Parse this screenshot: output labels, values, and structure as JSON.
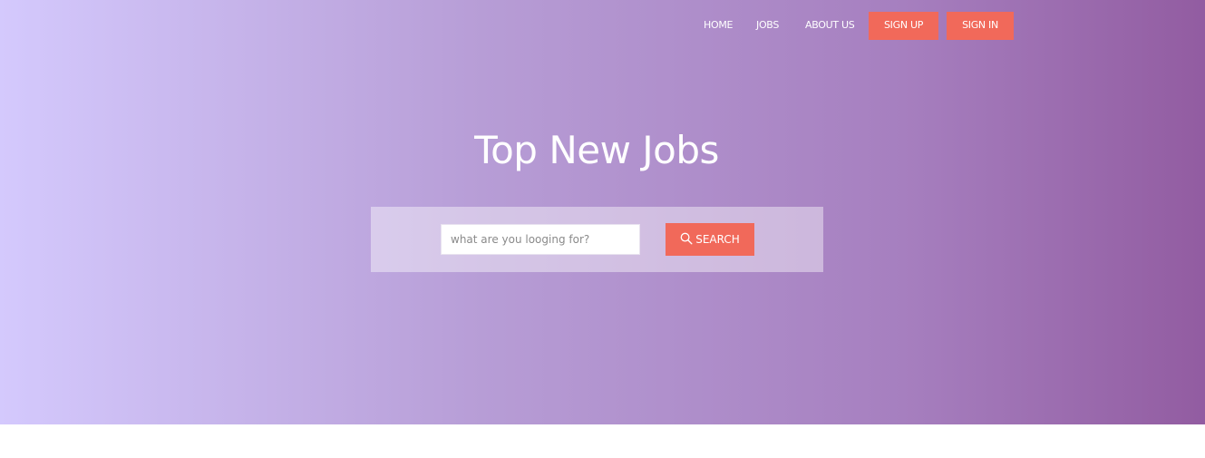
{
  "nav": {
    "home": "HOME",
    "jobs": "JOBS",
    "about": "ABOUT US",
    "sign_up": "SIGN UP",
    "sign_in": "SIGN IN"
  },
  "hero": {
    "title": "Top New Jobs"
  },
  "search": {
    "placeholder": "what are you looging for?",
    "value": "",
    "button_label": "SEARCH",
    "button_icon": "search-icon"
  },
  "colors": {
    "accent": "#f1695a",
    "gradient_start": "#d4c9fd",
    "gradient_end": "#925ca1"
  }
}
